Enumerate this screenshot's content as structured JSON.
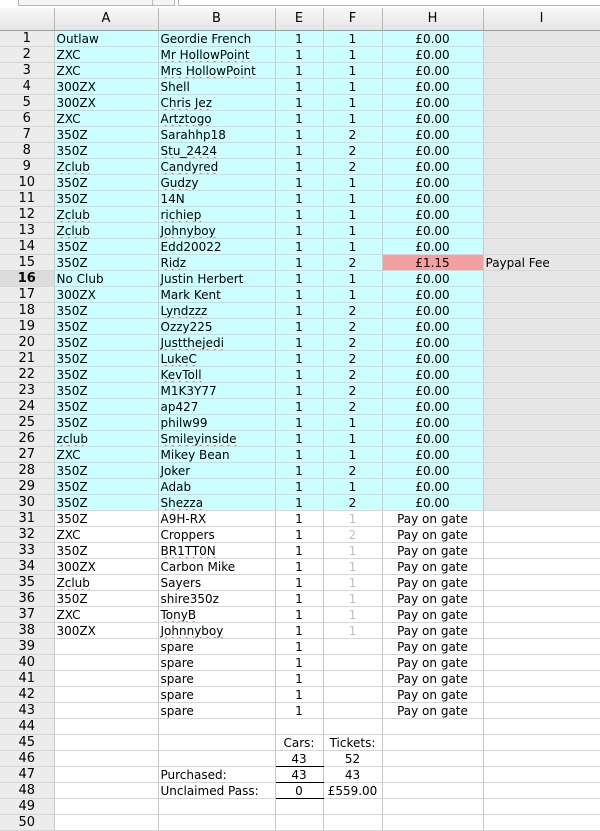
{
  "columns": [
    "A",
    "B",
    "E",
    "F",
    "H",
    "I"
  ],
  "rows": [
    {
      "n": "1",
      "a": "Outlaw",
      "b": "Geordie French",
      "e": "1",
      "f": "1",
      "h": "£0.00",
      "i": "",
      "style": "cy"
    },
    {
      "n": "2",
      "a": "ZXC",
      "b": "Mr HollowPoint",
      "e": "1",
      "f": "1",
      "h": "£0.00",
      "i": "",
      "style": "cy",
      "spb": true
    },
    {
      "n": "3",
      "a": "ZXC",
      "b": "Mrs HollowPoint",
      "e": "1",
      "f": "1",
      "h": "£0.00",
      "i": "",
      "style": "cy",
      "spb": true
    },
    {
      "n": "4",
      "a": "300ZX",
      "b": "Shell",
      "e": "1",
      "f": "1",
      "h": "£0.00",
      "i": "",
      "style": "cy"
    },
    {
      "n": "5",
      "a": "300ZX",
      "b": "Chris Jez",
      "e": "1",
      "f": "1",
      "h": "£0.00",
      "i": "",
      "style": "cy",
      "spb": true
    },
    {
      "n": "6",
      "a": "ZXC",
      "b": "Artztogo",
      "e": "1",
      "f": "1",
      "h": "£0.00",
      "i": "",
      "style": "cy",
      "spb": true
    },
    {
      "n": "7",
      "a": "350Z",
      "b": "Sarahhp18",
      "e": "1",
      "f": "2",
      "h": "£0.00",
      "i": "",
      "style": "cy"
    },
    {
      "n": "8",
      "a": "350Z",
      "b": "Stu_2424",
      "e": "1",
      "f": "2",
      "h": "£0.00",
      "i": "",
      "style": "cy",
      "spb": true
    },
    {
      "n": "9",
      "a": "Zclub",
      "b": "Candyred",
      "e": "1",
      "f": "2",
      "h": "£0.00",
      "i": "",
      "style": "cy",
      "spa": true,
      "spb": true
    },
    {
      "n": "10",
      "a": "350Z",
      "b": "Gudzy",
      "e": "1",
      "f": "1",
      "h": "£0.00",
      "i": "",
      "style": "cy",
      "spb": true
    },
    {
      "n": "11",
      "a": "350Z",
      "b": "14N",
      "e": "1",
      "f": "1",
      "h": "£0.00",
      "i": "",
      "style": "cy"
    },
    {
      "n": "12",
      "a": "Zclub",
      "b": "richiep",
      "e": "1",
      "f": "1",
      "h": "£0.00",
      "i": "",
      "style": "cy",
      "spa": true,
      "spb": true
    },
    {
      "n": "13",
      "a": "Zclub",
      "b": "Johnyboy",
      "e": "1",
      "f": "1",
      "h": "£0.00",
      "i": "",
      "style": "cy",
      "spa": true,
      "spb": true
    },
    {
      "n": "14",
      "a": "350Z",
      "b": "Edd20022",
      "e": "1",
      "f": "1",
      "h": "£0.00",
      "i": "",
      "style": "cy"
    },
    {
      "n": "15",
      "a": "350Z",
      "b": "Ridz",
      "e": "1",
      "f": "2",
      "h": "£1.15",
      "i": "Paypal Fee",
      "style": "cy",
      "fee": true,
      "spb": true
    },
    {
      "n": "16",
      "a": "No Club",
      "b": "Justin Herbert",
      "e": "1",
      "f": "1",
      "h": "£0.00",
      "i": "",
      "style": "cy",
      "sel": true
    },
    {
      "n": "17",
      "a": "300ZX",
      "b": "Mark Kent",
      "e": "1",
      "f": "1",
      "h": "£0.00",
      "i": "",
      "style": "cy"
    },
    {
      "n": "18",
      "a": "350Z",
      "b": "Lyndzzz",
      "e": "1",
      "f": "2",
      "h": "£0.00",
      "i": "",
      "style": "cy",
      "spb": true
    },
    {
      "n": "19",
      "a": "350Z",
      "b": "Ozzy225",
      "e": "1",
      "f": "2",
      "h": "£0.00",
      "i": "",
      "style": "cy"
    },
    {
      "n": "20",
      "a": "350Z",
      "b": "Justthejedi",
      "e": "1",
      "f": "2",
      "h": "£0.00",
      "i": "",
      "style": "cy",
      "spb": true
    },
    {
      "n": "21",
      "a": "350Z",
      "b": "LukeC",
      "e": "1",
      "f": "2",
      "h": "£0.00",
      "i": "",
      "style": "cy",
      "spb": true
    },
    {
      "n": "22",
      "a": "350Z",
      "b": "KevToll",
      "e": "1",
      "f": "2",
      "h": "£0.00",
      "i": "",
      "style": "cy",
      "spb": true
    },
    {
      "n": "23",
      "a": "350Z",
      "b": "M1K3Y77",
      "e": "1",
      "f": "2",
      "h": "£0.00",
      "i": "",
      "style": "cy"
    },
    {
      "n": "24",
      "a": "350Z",
      "b": "ap427",
      "e": "1",
      "f": "2",
      "h": "£0.00",
      "i": "",
      "style": "cy"
    },
    {
      "n": "25",
      "a": "350Z",
      "b": "philw99",
      "e": "1",
      "f": "1",
      "h": "£0.00",
      "i": "",
      "style": "cy"
    },
    {
      "n": "26",
      "a": "zclub",
      "b": "Smileyinside",
      "e": "1",
      "f": "1",
      "h": "£0.00",
      "i": "",
      "style": "cy",
      "spa": true,
      "spb": true
    },
    {
      "n": "27",
      "a": "ZXC",
      "b": "Mikey Bean",
      "e": "1",
      "f": "1",
      "h": "£0.00",
      "i": "",
      "style": "cy"
    },
    {
      "n": "28",
      "a": "350Z",
      "b": "Joker",
      "e": "1",
      "f": "2",
      "h": "£0.00",
      "i": "",
      "style": "cy"
    },
    {
      "n": "29",
      "a": "350Z",
      "b": "Adab",
      "e": "1",
      "f": "1",
      "h": "£0.00",
      "i": "",
      "style": "cy"
    },
    {
      "n": "30",
      "a": "350Z",
      "b": "Shezza",
      "e": "1",
      "f": "2",
      "h": "£0.00",
      "i": "",
      "style": "cy",
      "spb": true
    },
    {
      "n": "31",
      "a": "350Z",
      "b": "A9H-RX",
      "e": "1",
      "f": "1",
      "h": "Pay on gate",
      "i": "",
      "style": "plain",
      "gf": true,
      "top": true
    },
    {
      "n": "32",
      "a": "ZXC",
      "b": "Croppers",
      "e": "1",
      "f": "2",
      "h": "Pay on gate",
      "i": "",
      "style": "plain",
      "gf": true
    },
    {
      "n": "33",
      "a": "350Z",
      "b": "BR1TT0N",
      "e": "1",
      "f": "1",
      "h": "Pay on gate",
      "i": "",
      "style": "plain",
      "gf": true,
      "spb": true
    },
    {
      "n": "34",
      "a": "300ZX",
      "b": "Carbon Mike",
      "e": "1",
      "f": "1",
      "h": "Pay on gate",
      "i": "",
      "style": "plain",
      "gf": true
    },
    {
      "n": "35",
      "a": "Zclub",
      "b": "Sayers",
      "e": "1",
      "f": "1",
      "h": "Pay on gate",
      "i": "",
      "style": "plain",
      "gf": true,
      "spa": true
    },
    {
      "n": "36",
      "a": "350Z",
      "b": "shire350z",
      "e": "1",
      "f": "1",
      "h": "Pay on gate",
      "i": "",
      "style": "plain",
      "gf": true
    },
    {
      "n": "37",
      "a": "ZXC",
      "b": "TonyB",
      "e": "1",
      "f": "1",
      "h": "Pay on gate",
      "i": "",
      "style": "plain",
      "gf": true,
      "spb": true
    },
    {
      "n": "38",
      "a": "300ZX",
      "b": "Johnnyboy",
      "e": "1",
      "f": "1",
      "h": "Pay on gate",
      "i": "",
      "style": "plain",
      "gf": true,
      "spb": true
    },
    {
      "n": "39",
      "a": "",
      "b": "spare",
      "e": "1",
      "f": "",
      "h": "Pay on gate",
      "i": "",
      "style": "plain",
      "top": true
    },
    {
      "n": "40",
      "a": "",
      "b": "spare",
      "e": "1",
      "f": "",
      "h": "Pay on gate",
      "i": "",
      "style": "plain"
    },
    {
      "n": "41",
      "a": "",
      "b": "spare",
      "e": "1",
      "f": "",
      "h": "Pay on gate",
      "i": "",
      "style": "plain"
    },
    {
      "n": "42",
      "a": "",
      "b": "spare",
      "e": "1",
      "f": "",
      "h": "Pay on gate",
      "i": "",
      "style": "plain"
    },
    {
      "n": "43",
      "a": "",
      "b": "spare",
      "e": "1",
      "f": "",
      "h": "Pay on gate",
      "i": "",
      "style": "plain"
    },
    {
      "n": "44",
      "a": "",
      "b": "",
      "e": "",
      "f": "",
      "h": "",
      "i": "",
      "style": "plain",
      "top": true
    },
    {
      "n": "45",
      "a": "",
      "b": "",
      "e": "Cars:",
      "f": "Tickets:",
      "h": "",
      "i": "",
      "style": "plain"
    },
    {
      "n": "46",
      "a": "",
      "b": "",
      "e": "43",
      "f": "52",
      "h": "",
      "i": "",
      "style": "plain",
      "ulE": true
    },
    {
      "n": "47",
      "a": "",
      "b": "Purchased:",
      "e": "43",
      "f": "43",
      "h": "",
      "i": "",
      "style": "plain",
      "ulE": true
    },
    {
      "n": "48",
      "a": "",
      "b": "Unclaimed Pass:",
      "e": "0",
      "f": "£559.00",
      "h": "",
      "i": "",
      "style": "plain",
      "ulE": true
    },
    {
      "n": "49",
      "a": "",
      "b": "",
      "e": "",
      "f": "",
      "h": "",
      "i": "",
      "style": "plain"
    },
    {
      "n": "50",
      "a": "",
      "b": "",
      "e": "",
      "f": "",
      "h": "",
      "i": "",
      "style": "plain"
    }
  ]
}
